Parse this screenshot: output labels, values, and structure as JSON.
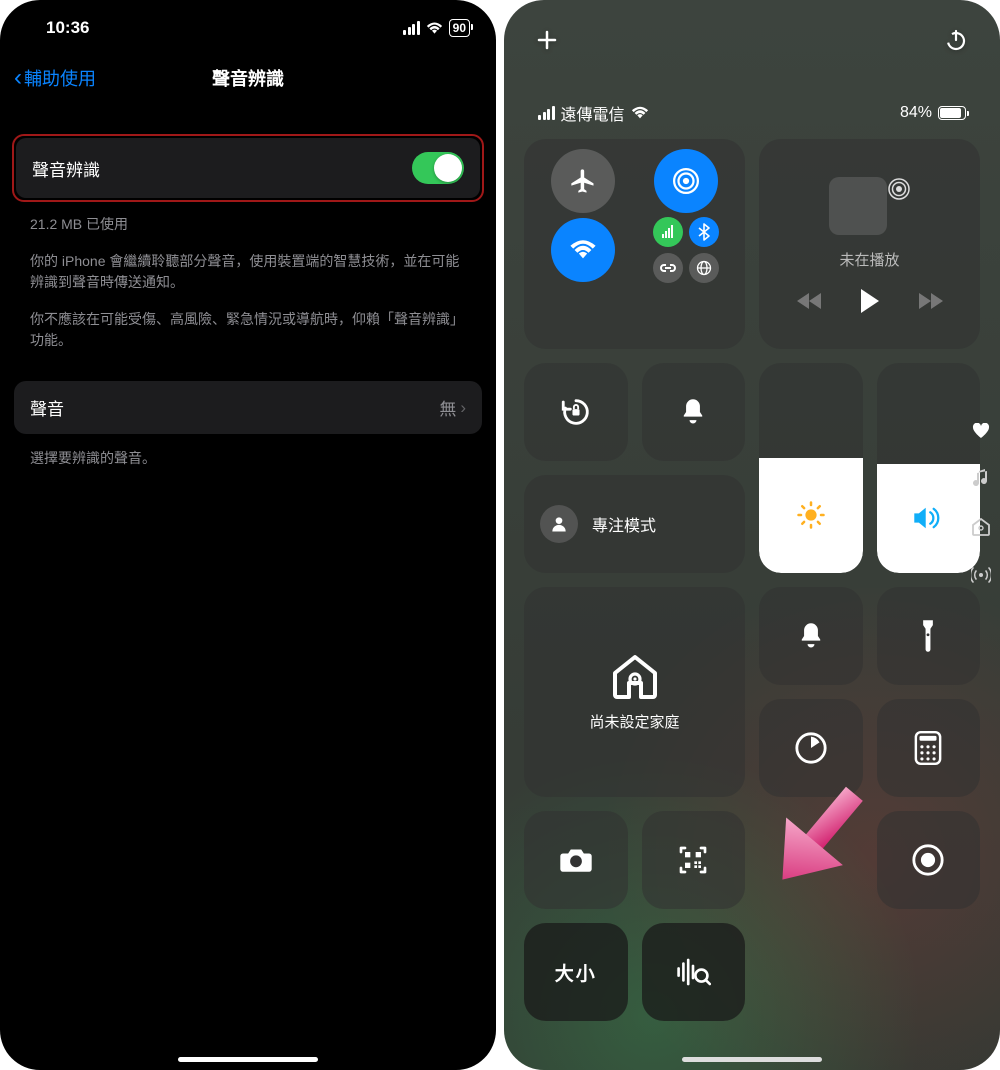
{
  "left": {
    "time": "10:36",
    "battery": "90",
    "back_label": "輔助使用",
    "title": "聲音辨識",
    "toggle_label": "聲音辨識",
    "storage_note": "21.2 MB 已使用",
    "description1": "你的 iPhone 會繼續聆聽部分聲音，使用裝置端的智慧技術，並在可能辨識到聲音時傳送通知。",
    "description2": "你不應該在可能受傷、高風險、緊急情況或導航時，仰賴「聲音辨識」功能。",
    "sounds_label": "聲音",
    "sounds_value": "無",
    "choose_note": "選擇要辨識的聲音。"
  },
  "right": {
    "carrier": "遠傳電信",
    "battery_pct": "84%",
    "now_playing": "未在播放",
    "focus_label": "專注模式",
    "home_label": "尚未設定家庭",
    "text_size_label": "大小"
  }
}
